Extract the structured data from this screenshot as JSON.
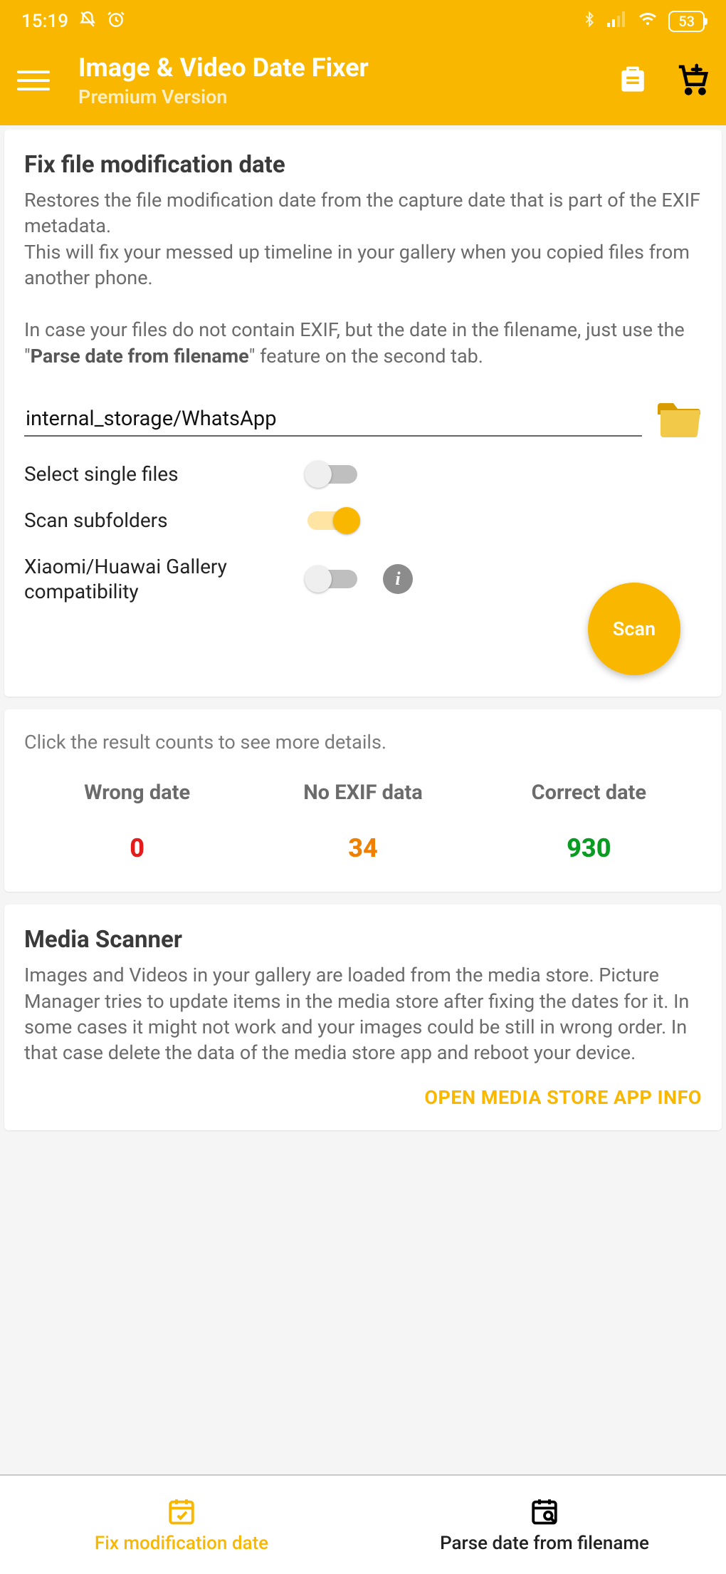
{
  "status": {
    "time": "15:19",
    "battery": "53"
  },
  "appbar": {
    "title": "Image & Video Date Fixer",
    "subtitle": "Premium Version"
  },
  "card1": {
    "title": "Fix file modification date",
    "p1": "Restores the file modification date from the capture date that is part of the EXIF metadata.",
    "p2": "This will fix your messed up timeline in your gallery when you copied files from another phone.",
    "p3a": "In case your files do not contain EXIF, but the date in the filename, just use the \"",
    "p3bold": "Parse date from filename",
    "p3b": "\" feature on the second tab.",
    "path": "internal_storage/WhatsApp",
    "opt1": "Select single files",
    "opt2": "Scan subfolders",
    "opt3": "Xiaomi/Huawai Gallery compatibility",
    "scan": "Scan"
  },
  "card2": {
    "hint": "Click the result counts to see more details.",
    "h1": "Wrong date",
    "v1": "0",
    "h2": "No EXIF data",
    "v2": "34",
    "h3": "Correct date",
    "v3": "930"
  },
  "card3": {
    "title": "Media Scanner",
    "desc": "Images and Videos in your gallery are loaded from the media store. Picture Manager tries to update items in the media store after fixing the dates for it. In some cases it might not work and your images could be still in wrong order. In that case delete the data of the media store app and reboot your device.",
    "link": "OPEN MEDIA STORE APP INFO"
  },
  "nav": {
    "tab1": "Fix modification date",
    "tab2": "Parse date from filename"
  }
}
